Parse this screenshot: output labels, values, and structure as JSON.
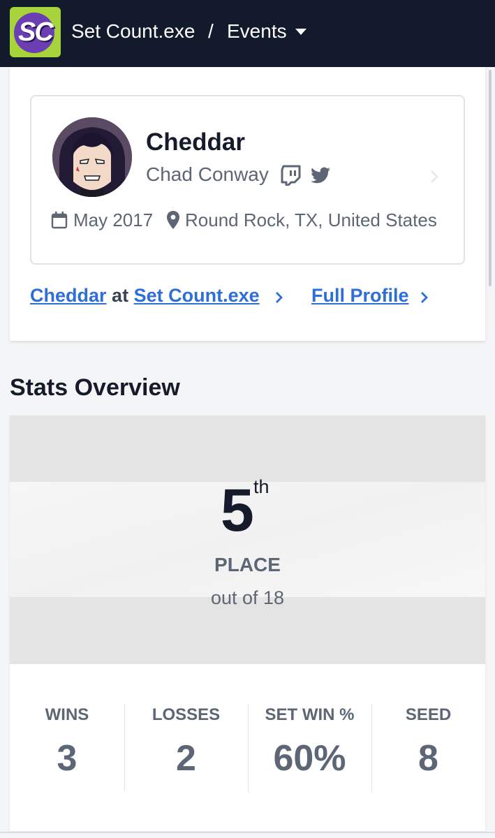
{
  "header": {
    "logo_text": "SC",
    "app_name": "Set Count.exe",
    "separator": "/",
    "section": "Events"
  },
  "profile": {
    "tag": "Cheddar",
    "real_name": "Chad Conway",
    "joined": "May 2017",
    "location": "Round Rock, TX, United States",
    "icons": [
      "twitch-icon",
      "twitter-icon",
      "calendar-icon",
      "location-pin-icon"
    ]
  },
  "links": {
    "player_link": "Cheddar",
    "at_word": "at",
    "org_link": "Set Count.exe",
    "full_profile": "Full Profile"
  },
  "stats": {
    "title": "Stats Overview",
    "placement": "5",
    "placement_suffix": "th",
    "placement_label": "PLACE",
    "out_of": "out of 18",
    "items": [
      {
        "label": "WINS",
        "value": "3"
      },
      {
        "label": "LOSSES",
        "value": "2"
      },
      {
        "label": "SET WIN %",
        "value": "60%"
      },
      {
        "label": "SEED",
        "value": "8"
      }
    ]
  },
  "colors": {
    "topbar": "#131a2b",
    "link": "#2d6fd6",
    "muted_text": "#5c6675",
    "logo_green": "#a6d43a",
    "logo_purple": "#6b3fb3"
  }
}
